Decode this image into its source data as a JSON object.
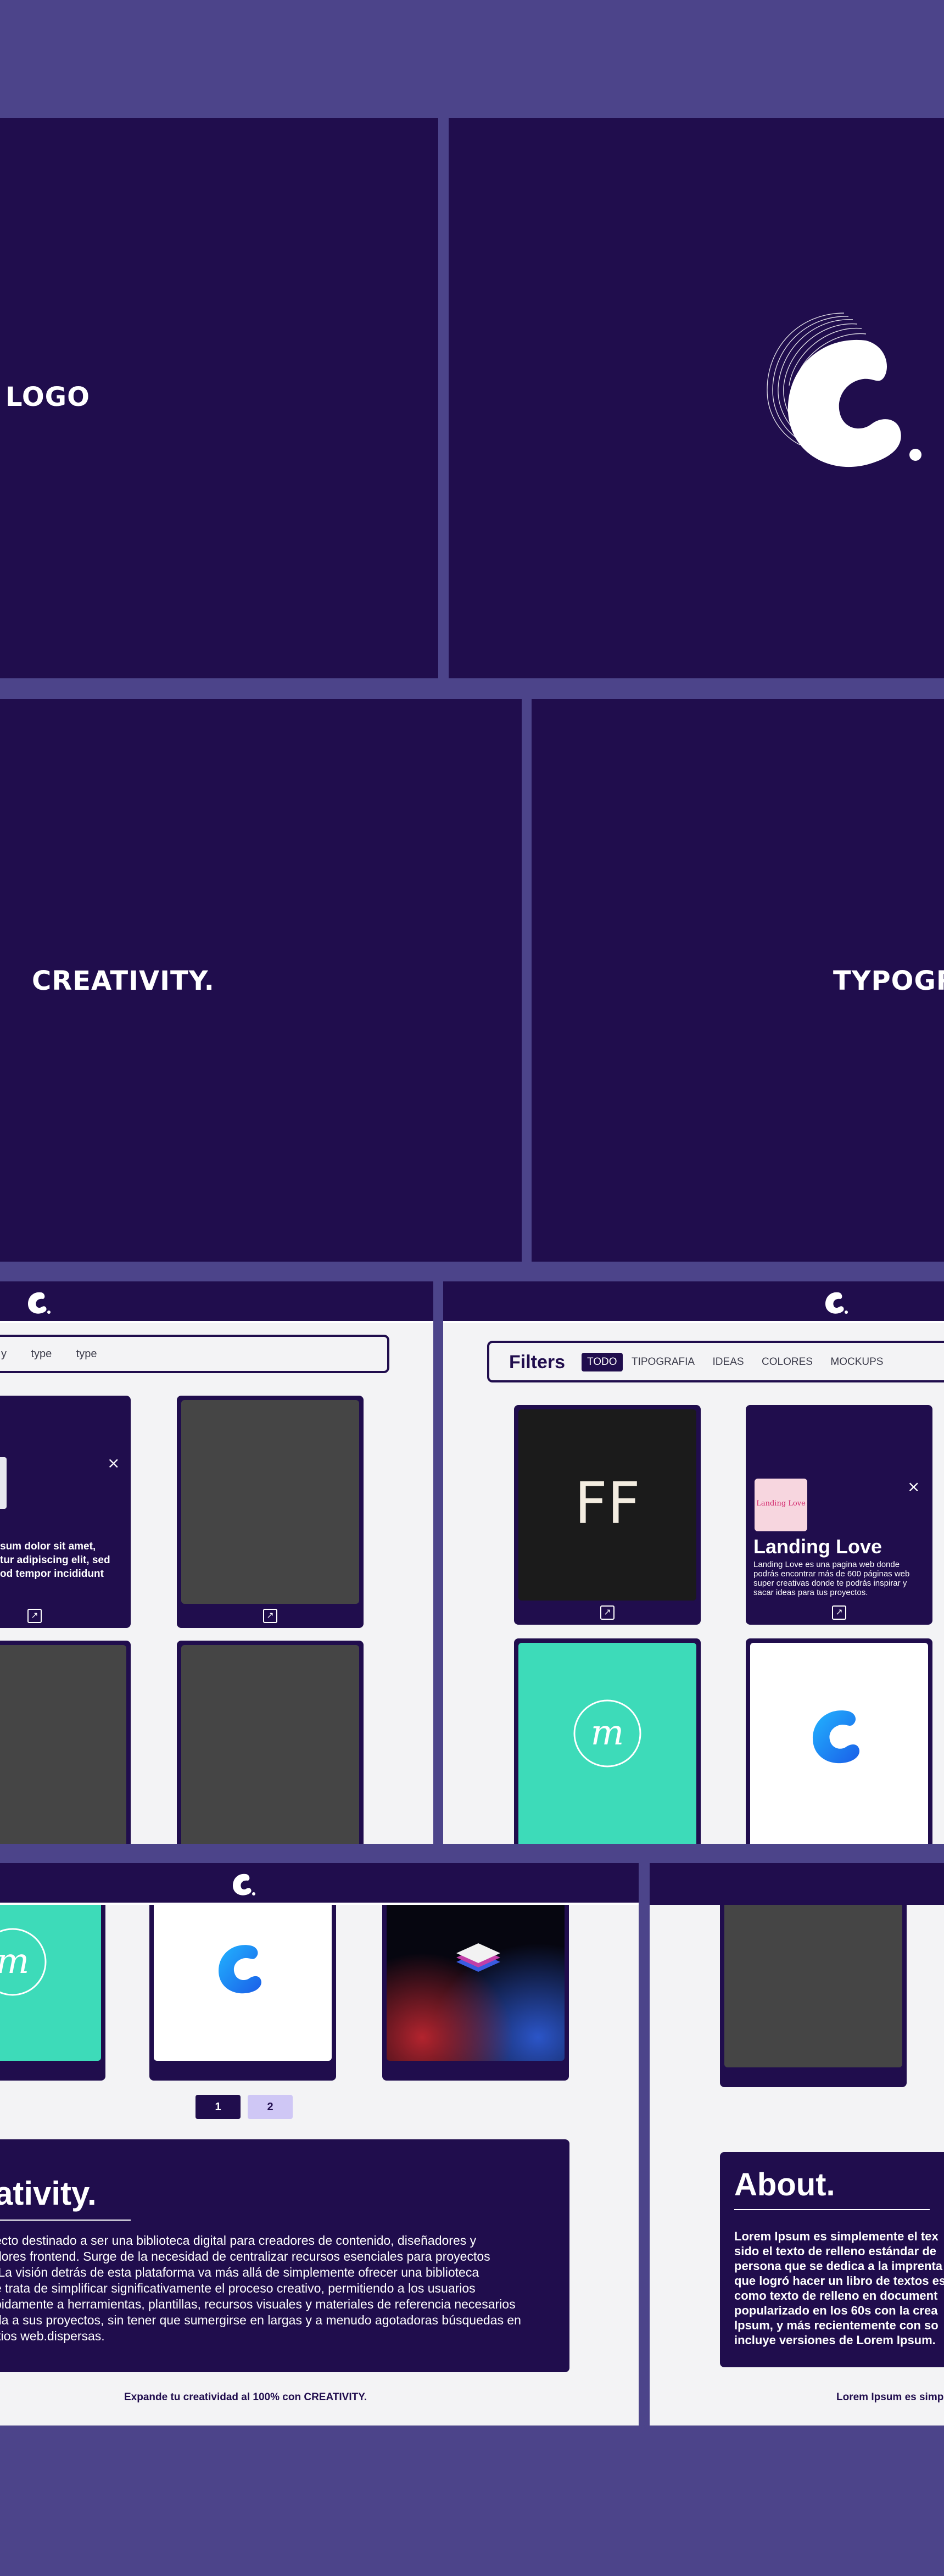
{
  "colors": {
    "background": "#4c448a",
    "brand_dark": "#200d4d",
    "light_bg": "#f3f3f5",
    "teal": "#3ddbb9",
    "accent_blue": "#1a8cff",
    "pager_inactive": "#cfc7f5"
  },
  "panels": {
    "logo": {
      "title": "LOGO"
    },
    "creativity": {
      "title": "CREATIVITY."
    },
    "typography": {
      "title": "TYPOGR"
    }
  },
  "browse": {
    "search_chips": [
      "y",
      "type",
      "type"
    ],
    "popup_text": "sum dolor sit amet,\ntur adipiscing elit, sed\nod tempor incididunt"
  },
  "filters": {
    "title": "Filters",
    "tabs": [
      "TODO",
      "TIPOGRAFIA",
      "IDEAS",
      "COLORES",
      "MOCKUPS"
    ],
    "active_tab": "TODO",
    "ff_card_text": "FF",
    "landing_card": {
      "thumb_text": "Landing Love",
      "title": "Landing Love",
      "description": "Landing Love es una pagina web donde podrás encontrar más de 600 páginas web super creativas donde te podrás inspirar y sacar ideas para tus proyectos."
    }
  },
  "home": {
    "pager": [
      "1",
      "2"
    ],
    "about_title": "ativity.",
    "about_text": "ecto destinado a ser una biblioteca digital para creadores de contenido, diseñadores y\ndores frontend. Surge de la necesidad de centralizar recursos esenciales para proyectos\n.La visión detrás de esta plataforma va más allá de simplemente ofrecer una biblioteca\ne trata de simplificar significativamente el proceso creativo, permitiendo a los usuarios\npidamente a herramientas, plantillas, recursos visuales y materiales de referencia necesarios\nda a sus proyectos, sin tener que sumergirse en largas y a menudo agotadoras búsquedas en\nitios web.dispersas.",
    "footer": "Expande tu creatividad al 100% con CREATIVITY."
  },
  "about_page": {
    "title": "About.",
    "text": "Lorem Ipsum es simplemente el tex\nsido el texto de relleno estándar de\npersona que se dedica a la imprenta\nque logró hacer un libro de textos es\ncomo texto de relleno en document\npopularizado en los 60s con la crea\nIpsum, y más recientemente con so\nincluye versiones de Lorem Ipsum.",
    "footer": "Lorem Ipsum es simp"
  }
}
